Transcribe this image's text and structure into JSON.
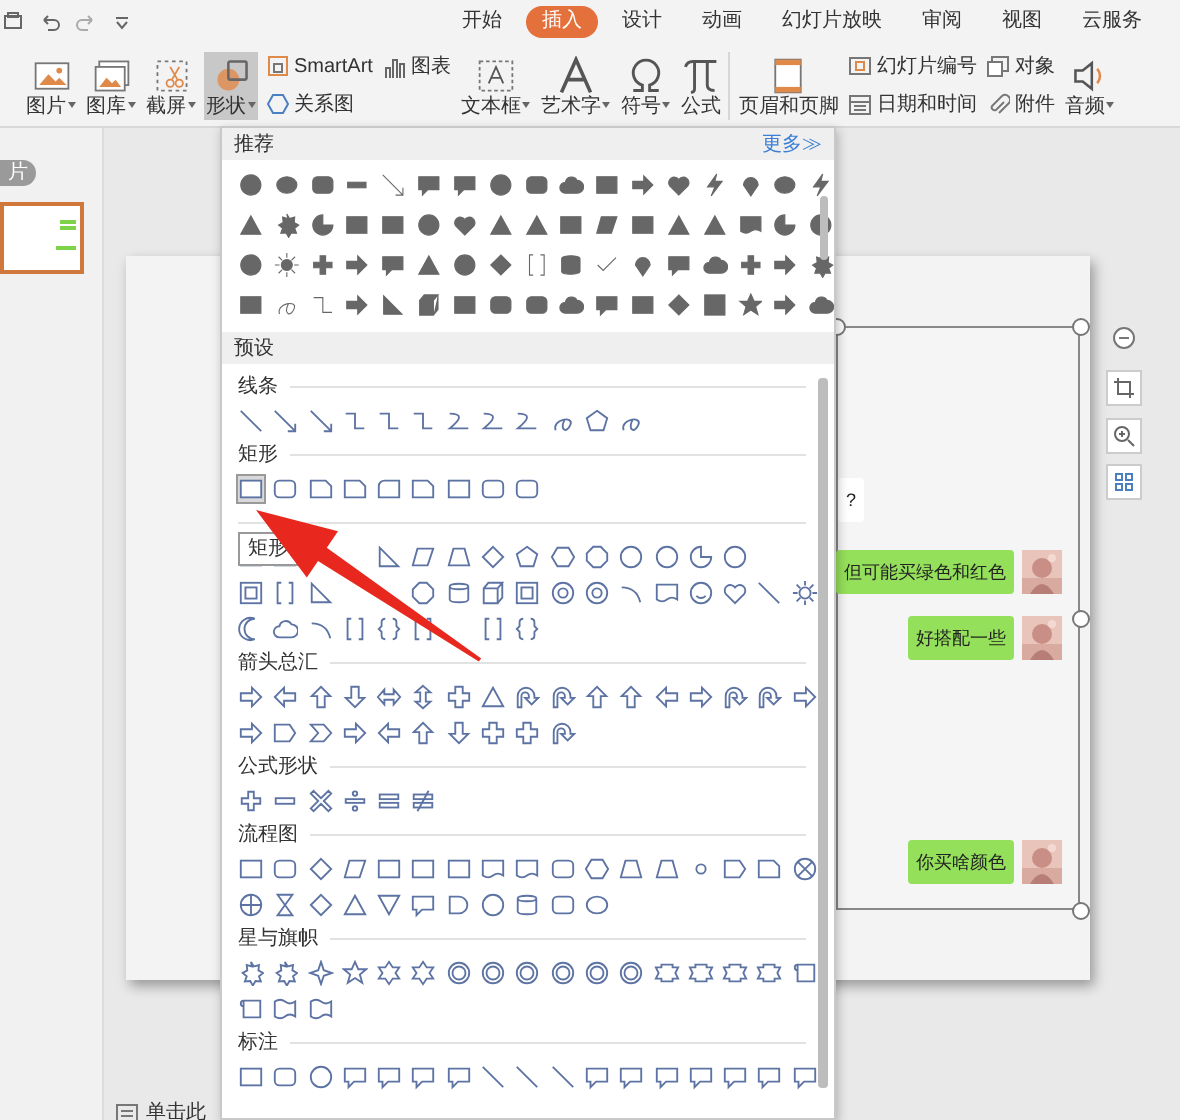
{
  "menu_tabs": [
    {
      "label": "开始",
      "selected": false
    },
    {
      "label": "插入",
      "selected": true
    },
    {
      "label": "设计",
      "selected": false
    },
    {
      "label": "动画",
      "selected": false
    },
    {
      "label": "幻灯片放映",
      "selected": false
    },
    {
      "label": "审阅",
      "selected": false
    },
    {
      "label": "视图",
      "selected": false
    },
    {
      "label": "云服务",
      "selected": false
    }
  ],
  "ribbon": [
    {
      "kind": "large",
      "label": "图片",
      "dropdown": true,
      "selected": false
    },
    {
      "kind": "large",
      "label": "图库",
      "dropdown": true,
      "selected": false
    },
    {
      "kind": "large",
      "label": "截屏",
      "dropdown": true,
      "selected": false
    },
    {
      "kind": "large",
      "label": "形状",
      "dropdown": true,
      "selected": true
    },
    {
      "kind": "stack",
      "items": [
        {
          "label": "SmartArt"
        },
        {
          "label": "关系图"
        }
      ]
    },
    {
      "kind": "stack",
      "items": [
        {
          "label": "图表"
        }
      ]
    },
    {
      "kind": "large",
      "label": "文本框",
      "dropdown": true,
      "selected": false
    },
    {
      "kind": "large",
      "label": "艺术字",
      "dropdown": true,
      "selected": false
    },
    {
      "kind": "large",
      "label": "符号",
      "dropdown": true,
      "selected": false
    },
    {
      "kind": "large",
      "label": "公式",
      "dropdown": false,
      "selected": false
    },
    {
      "kind": "large",
      "label": "页眉和页脚",
      "dropdown": false,
      "selected": false
    },
    {
      "kind": "stack",
      "items": [
        {
          "label": "幻灯片编号"
        },
        {
          "label": "日期和时间"
        }
      ]
    },
    {
      "kind": "stack",
      "items": [
        {
          "label": "对象"
        },
        {
          "label": "附件"
        }
      ]
    },
    {
      "kind": "large",
      "label": "音频",
      "dropdown": true,
      "selected": false
    }
  ],
  "slides_pane": {
    "tab": "片"
  },
  "shapes_panel": {
    "recommended": {
      "title": "推荐",
      "more": "更多≫"
    },
    "preset_title": "预设",
    "tooltip": "矩形",
    "sections": [
      {
        "kind": "titled",
        "title": "线条"
      },
      {
        "kind": "titled",
        "title": "矩形",
        "shapes": [
          {
            "selected": true
          },
          {
            "selected": false
          },
          {
            "selected": false
          },
          {
            "selected": false
          },
          {
            "selected": false
          },
          {
            "selected": false
          },
          {
            "selected": false
          },
          {
            "selected": false
          },
          {
            "selected": false
          }
        ]
      },
      {
        "kind": "untitled"
      },
      {
        "kind": "titled",
        "title": "箭头总汇"
      },
      {
        "kind": "titled",
        "title": "公式形状"
      },
      {
        "kind": "titled",
        "title": "流程图"
      },
      {
        "kind": "titled",
        "title": "星与旗帜"
      },
      {
        "kind": "titled",
        "title": "标注"
      }
    ]
  },
  "chat_screenshot": {
    "messages": [
      {
        "text": "?",
        "kind": "received"
      },
      {
        "text": "但可能买绿色和红色",
        "kind": "sent"
      },
      {
        "text": "好搭配一些",
        "kind": "sent"
      },
      {
        "text": "你买啥颜色",
        "kind": "sent"
      }
    ]
  },
  "notes_hint": "单击此"
}
